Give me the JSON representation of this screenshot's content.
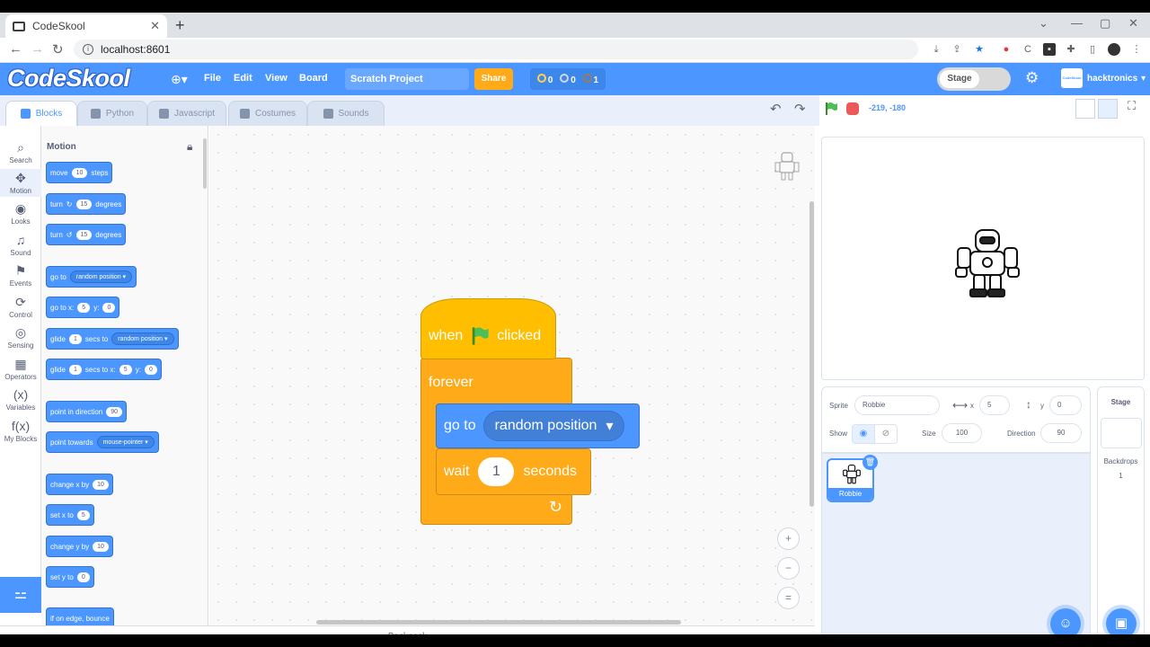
{
  "browser": {
    "tab_title": "CodeSkool",
    "tab_close": "✕",
    "new_tab": "+",
    "url": "localhost:8601",
    "info": "i"
  },
  "menubar": {
    "logo": "CodeSkool",
    "globe": "⊕▾",
    "file": "File",
    "edit": "Edit",
    "view": "View",
    "board": "Board",
    "project_name": "Scratch Project",
    "share": "Share",
    "badge_gold": "0",
    "badge_silver": "0",
    "badge_bronze": "1",
    "stage_toggle": "Stage",
    "account": "hacktronics",
    "account_logo": "CodeSkool"
  },
  "editor_tabs": {
    "blocks": "Blocks",
    "python": "Python",
    "javascript": "Javascript",
    "costumes": "Costumes",
    "sounds": "Sounds"
  },
  "stage_controls": {
    "coords": "-219, -180"
  },
  "categories": [
    {
      "label": "Search",
      "icon": "⌕"
    },
    {
      "label": "Motion",
      "icon": "✥"
    },
    {
      "label": "Looks",
      "icon": "◉"
    },
    {
      "label": "Sound",
      "icon": "♫"
    },
    {
      "label": "Events",
      "icon": "⚑"
    },
    {
      "label": "Control",
      "icon": "⟳"
    },
    {
      "label": "Sensing",
      "icon": "◎"
    },
    {
      "label": "Operators",
      "icon": "▦"
    },
    {
      "label": "Variables",
      "icon": "(x)"
    },
    {
      "label": "My Blocks",
      "icon": "f(x)"
    }
  ],
  "palette": {
    "title": "Motion",
    "move": {
      "a": "move",
      "v": "10",
      "b": "steps"
    },
    "turn_right": {
      "a": "turn",
      "v": "15",
      "b": "degrees"
    },
    "turn_left": {
      "a": "turn",
      "v": "15",
      "b": "degrees"
    },
    "goto_random": {
      "a": "go to",
      "d": "random position ▾"
    },
    "goto_xy": {
      "a": "go to x:",
      "x": "5",
      "b": "y:",
      "y": "0"
    },
    "glide_random": {
      "a": "glide",
      "v": "1",
      "b": "secs to",
      "d": "random position ▾"
    },
    "glide_xy": {
      "a": "glide",
      "v": "1",
      "b": "secs to x:",
      "x": "5",
      "c": "y:",
      "y": "0"
    },
    "point_dir": {
      "a": "point in direction",
      "v": "90"
    },
    "point_towards": {
      "a": "point towards",
      "d": "mouse-pointer ▾"
    },
    "change_x": {
      "a": "change x by",
      "v": "10"
    },
    "set_x": {
      "a": "set x to",
      "v": "5"
    },
    "change_y": {
      "a": "change y by",
      "v": "10"
    },
    "set_y": {
      "a": "set y to",
      "v": "0"
    },
    "bounce": {
      "a": "if on edge, bounce"
    }
  },
  "script": {
    "when": "when",
    "clicked": "clicked",
    "forever": "forever",
    "goto": "go to",
    "goto_target": "random position",
    "wait": "wait",
    "wait_value": "1",
    "seconds": "seconds",
    "loop_arrow": "↻",
    "dropdown_arrow": "▾"
  },
  "zoom": {
    "in": "+",
    "out": "−",
    "reset": "="
  },
  "backpack": "Backpack",
  "sprite_info": {
    "sprite_label": "Sprite",
    "sprite_name": "Robbie",
    "x_label": "x",
    "x_value": "5",
    "y_label": "y",
    "y_value": "0",
    "show_label": "Show",
    "size_label": "Size",
    "size_value": "100",
    "direction_label": "Direction",
    "direction_value": "90"
  },
  "sprite_card": {
    "name": "Robbie"
  },
  "stage_panel": {
    "title": "Stage",
    "backdrops_label": "Backdrops",
    "backdrops_count": "1"
  }
}
